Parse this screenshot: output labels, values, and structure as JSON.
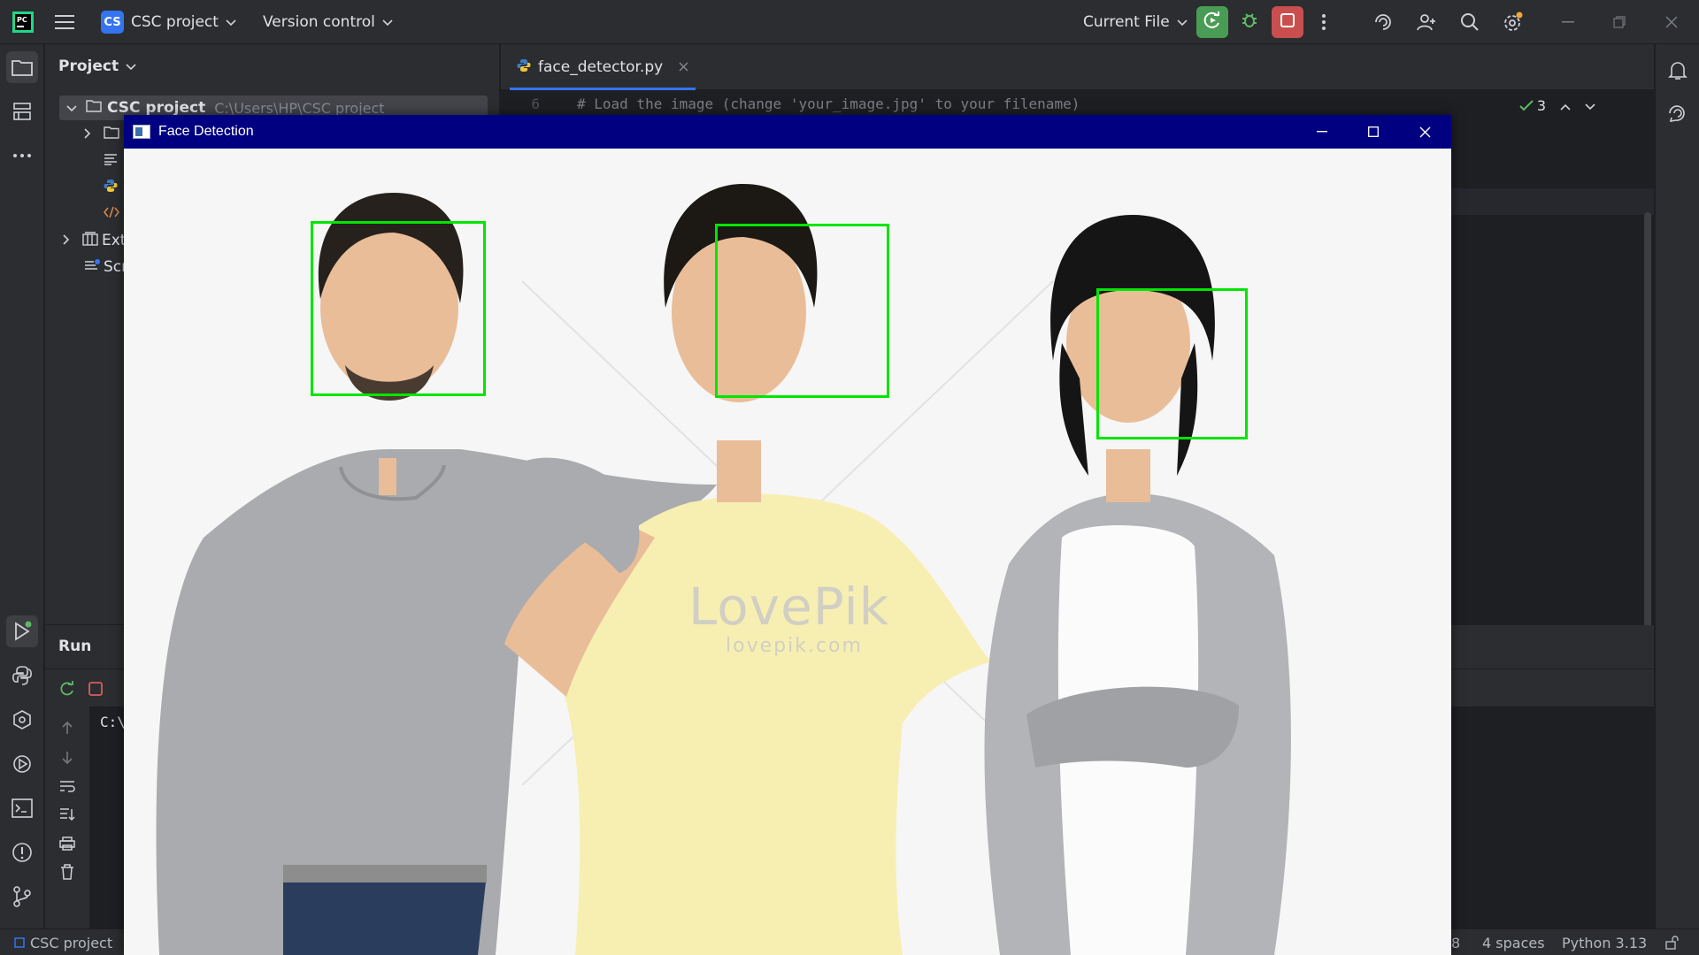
{
  "topbar": {
    "project_badge": "CS",
    "project_name": "CSC project",
    "vcs_label": "Version control",
    "run_config": "Current File"
  },
  "project_panel": {
    "title": "Project",
    "root_name": "CSC project",
    "root_path": "C:\\Users\\HP\\CSC project",
    "external_partial": "Ext",
    "scratches_partial": "Scr"
  },
  "editor": {
    "tab_file": "face_detector.py",
    "line_number": "6",
    "line_code": "# Load the image (change 'your_image.jpg' to your filename)",
    "inspection_count": "3"
  },
  "run_panel": {
    "title": "Run",
    "console_partial": "C:\\"
  },
  "statusbar": {
    "project": "CSC project",
    "line_partial": "8",
    "indent": "4 spaces",
    "interpreter": "Python 3.13"
  },
  "cv_window": {
    "title": "Face Detection",
    "watermark": "LovePik",
    "watermark_url": "lovepik.com",
    "detections": 3,
    "box_color": "#00e600"
  },
  "colors": {
    "accent": "#3574f0",
    "run_green": "#499c54",
    "stop_red": "#c94f4f",
    "titlebar_navy": "#000080"
  }
}
